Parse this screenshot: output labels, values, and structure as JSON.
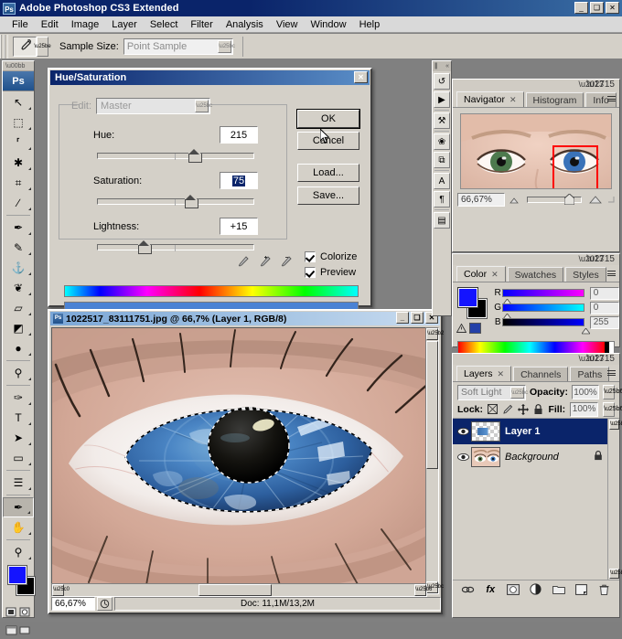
{
  "window": {
    "app_title": "Adobe Photoshop CS3 Extended",
    "logo": "Ps",
    "minimize": "_",
    "maximize": "❑",
    "close": "✕"
  },
  "menubar": {
    "items": [
      "File",
      "Edit",
      "Image",
      "Layer",
      "Select",
      "Filter",
      "Analysis",
      "View",
      "Window",
      "Help"
    ]
  },
  "options_bar": {
    "tool_icon": "eyedropper-icon",
    "sample_size_label": "Sample Size:",
    "sample_size_value": "Point Sample"
  },
  "toolbox": {
    "logo": "Ps",
    "tools": [
      {
        "name": "move-tool",
        "glyph": "↖"
      },
      {
        "name": "marquee-tool",
        "glyph": "⬚"
      },
      {
        "name": "lasso-tool",
        "glyph": "⸢"
      },
      {
        "name": "magic-wand-tool",
        "glyph": "✱"
      },
      {
        "name": "crop-tool",
        "glyph": "⌗"
      },
      {
        "name": "slice-tool",
        "glyph": "∕"
      },
      {
        "name": "healing-brush-tool",
        "glyph": "✒"
      },
      {
        "name": "brush-tool",
        "glyph": "✎"
      },
      {
        "name": "clone-stamp-tool",
        "glyph": "⚓"
      },
      {
        "name": "history-brush-tool",
        "glyph": "❦"
      },
      {
        "name": "eraser-tool",
        "glyph": "▱"
      },
      {
        "name": "gradient-tool",
        "glyph": "◩"
      },
      {
        "name": "blur-tool",
        "glyph": "●"
      },
      {
        "name": "dodge-tool",
        "glyph": "⚲"
      },
      {
        "name": "pen-tool",
        "glyph": "✑"
      },
      {
        "name": "type-tool",
        "glyph": "T"
      },
      {
        "name": "path-selection-tool",
        "glyph": "➤"
      },
      {
        "name": "shape-tool",
        "glyph": "▭"
      },
      {
        "name": "notes-tool",
        "glyph": "☰"
      },
      {
        "name": "eyedropper-tool",
        "glyph": "✒"
      },
      {
        "name": "hand-tool",
        "glyph": "✋"
      },
      {
        "name": "zoom-tool",
        "glyph": "⚲"
      }
    ],
    "foreground_color": "#1414ff",
    "background_color": "#000000",
    "quickmask_icon": "quick-mask-icon",
    "screenmode_icon": "screen-mode-icon"
  },
  "dialog": {
    "title": "Hue/Saturation",
    "close": "✕",
    "edit_label": "Edit:",
    "edit_value": "Master",
    "hue_label": "Hue:",
    "hue_value": "215",
    "saturation_label": "Saturation:",
    "saturation_value": "75",
    "lightness_label": "Lightness:",
    "lightness_value": "+15",
    "buttons": {
      "ok": "OK",
      "cancel": "Cancel",
      "load": "Load...",
      "save": "Save..."
    },
    "colorize_label": "Colorize",
    "preview_label": "Preview",
    "colorize_checked": true,
    "preview_checked": true,
    "result_color": "#4a82d4"
  },
  "document": {
    "title": "1022517_83111751.jpg @ 66,7% (Layer 1, RGB/8)",
    "icon": "Ps",
    "minimize": "_",
    "maximize": "❑",
    "close": "✕",
    "zoom": "66,67%",
    "doc_size": "Doc: 11,1M/13,2M"
  },
  "dock": {
    "collapse_icon": "«",
    "buttons": [
      {
        "name": "history-panel-icon",
        "glyph": "↺"
      },
      {
        "name": "actions-panel-icon",
        "glyph": "▶"
      },
      {
        "name": "tool-presets-panel-icon",
        "glyph": "⚒"
      },
      {
        "name": "brushes-panel-icon",
        "glyph": "❀"
      },
      {
        "name": "clone-source-panel-icon",
        "glyph": "⧉"
      },
      {
        "name": "character-panel-icon",
        "glyph": "A"
      },
      {
        "name": "paragraph-panel-icon",
        "glyph": "¶"
      },
      {
        "name": "layer-comps-panel-icon",
        "glyph": "▤"
      }
    ]
  },
  "navigator": {
    "tabs": [
      "Navigator",
      "Histogram",
      "Info"
    ],
    "active_tab": "Navigator",
    "zoom_value": "66,67%"
  },
  "color_panel": {
    "tabs": [
      "Color",
      "Swatches",
      "Styles"
    ],
    "active_tab": "Color",
    "channels": [
      {
        "label": "R",
        "value": "0"
      },
      {
        "label": "G",
        "value": "0"
      },
      {
        "label": "B",
        "value": "255"
      }
    ],
    "foreground": "#1414ff",
    "background": "#000000",
    "warning_icon": "out-of-gamut-warning-icon"
  },
  "layers_panel": {
    "tabs": [
      "Layers",
      "Channels",
      "Paths"
    ],
    "active_tab": "Layers",
    "blend_mode": "Soft Light",
    "opacity_label": "Opacity:",
    "opacity_value": "100%",
    "lock_label": "Lock:",
    "fill_label": "Fill:",
    "fill_value": "100%",
    "locks": [
      {
        "name": "lock-transparency-icon",
        "glyph": "⛶"
      },
      {
        "name": "lock-image-icon",
        "glyph": "✎"
      },
      {
        "name": "lock-position-icon",
        "glyph": "✛"
      },
      {
        "name": "lock-all-icon",
        "glyph": "ὑ2"
      }
    ],
    "layers": [
      {
        "name": "Layer 1",
        "selected": true,
        "italic": false,
        "locked": false,
        "thumb": "checker"
      },
      {
        "name": "Background",
        "selected": false,
        "italic": true,
        "locked": true,
        "thumb": "eyes"
      }
    ],
    "footer_icons": [
      {
        "name": "link-layers-icon",
        "glyph": "⚭"
      },
      {
        "name": "layer-style-icon",
        "glyph": "fx"
      },
      {
        "name": "layer-mask-icon",
        "glyph": "▣"
      },
      {
        "name": "adjustment-layer-icon",
        "glyph": "◑"
      },
      {
        "name": "new-group-icon",
        "glyph": "▭"
      },
      {
        "name": "new-layer-icon",
        "glyph": "❐"
      },
      {
        "name": "delete-layer-icon",
        "glyph": "☗"
      }
    ]
  }
}
